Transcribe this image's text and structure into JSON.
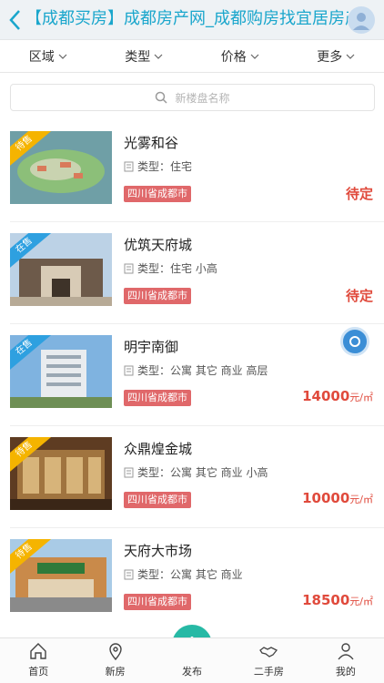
{
  "header": {
    "title": "【成都买房】成都房产网_成都购房找宜居房产网"
  },
  "filters": [
    {
      "label": "区域"
    },
    {
      "label": "类型"
    },
    {
      "label": "价格"
    },
    {
      "label": "更多"
    }
  ],
  "search": {
    "placeholder": "新楼盘名称"
  },
  "listings": [
    {
      "status": "待售",
      "status_color": "#f5b400",
      "name": "光雾和谷",
      "type": "类型：住宅",
      "region": "四川省成都市",
      "price": "待定",
      "unit": ""
    },
    {
      "status": "在售",
      "status_color": "#2ea0e0",
      "name": "优筑天府城",
      "type": "类型：住宅 小高",
      "region": "四川省成都市",
      "price": "待定",
      "unit": ""
    },
    {
      "status": "在售",
      "status_color": "#2ea0e0",
      "name": "明宇南御",
      "type": "类型：公寓 其它 商业 高层",
      "region": "四川省成都市",
      "price": "14000",
      "unit": "元/㎡"
    },
    {
      "status": "待售",
      "status_color": "#f5b400",
      "name": "众鼎煌金城",
      "type": "类型：公寓 其它 商业 小高",
      "region": "四川省成都市",
      "price": "10000",
      "unit": "元/㎡"
    },
    {
      "status": "待售",
      "status_color": "#f5b400",
      "name": "天府大市场",
      "type": "类型：公寓 其它 商业",
      "region": "四川省成都市",
      "price": "18500",
      "unit": "元/㎡"
    }
  ],
  "tabbar": [
    {
      "label": "首页",
      "icon": "home-icon"
    },
    {
      "label": "新房",
      "icon": "location-icon"
    },
    {
      "label": "发布",
      "icon": "plus-icon"
    },
    {
      "label": "二手房",
      "icon": "handshake-icon"
    },
    {
      "label": "我的",
      "icon": "user-icon"
    }
  ],
  "colors": {
    "accent": "#1aa6cc",
    "price": "#e04a3c",
    "region_tag": "#e0686a",
    "publish": "#27b9a5"
  }
}
